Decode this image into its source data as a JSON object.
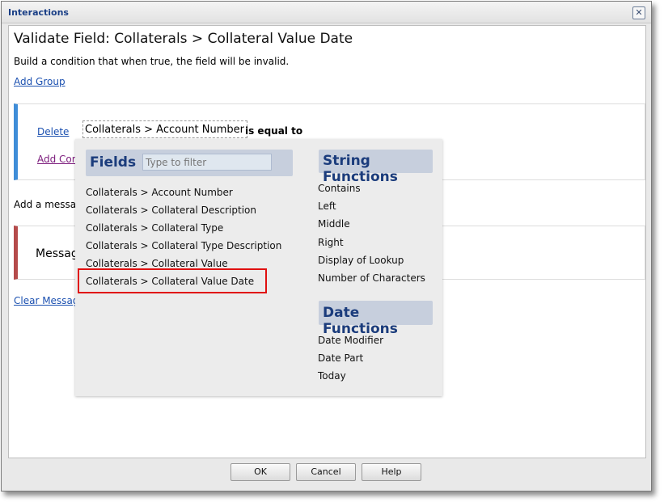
{
  "window": {
    "title": "Interactions",
    "close_glyph": "✕"
  },
  "heading": "Validate Field: Collaterals > Collateral Value Date",
  "description": "Build a condition that when true, the field will be invalid.",
  "add_group": "Add Group",
  "condition": {
    "delete": "Delete",
    "field": "Collaterals > Account Number",
    "operator": "is equal to",
    "add_condition": "Add Condi"
  },
  "add_message": "Add a messag",
  "message_label": "Message",
  "clear_message": "Clear Message",
  "popup": {
    "fields_title": "Fields",
    "filter_placeholder": "Type to filter",
    "fields": [
      "Collaterals > Account Number",
      "Collaterals > Collateral Description",
      "Collaterals > Collateral Type",
      "Collaterals > Collateral Type Description",
      "Collaterals > Collateral Value",
      "Collaterals > Collateral Value Date"
    ],
    "string_title": "String Functions",
    "string_functions": [
      "Contains",
      "Left",
      "Middle",
      "Right",
      "Display of Lookup",
      "Number of Characters"
    ],
    "date_title": "Date Functions",
    "date_functions": [
      "Date Modifier",
      "Date Part",
      "Today"
    ]
  },
  "buttons": {
    "ok": "OK",
    "cancel": "Cancel",
    "help": "Help"
  },
  "colors": {
    "condition_accent": "#3f8dd8",
    "message_accent": "#b54b4b",
    "highlight": "#e01010",
    "section_title": "#1b3c7c"
  }
}
